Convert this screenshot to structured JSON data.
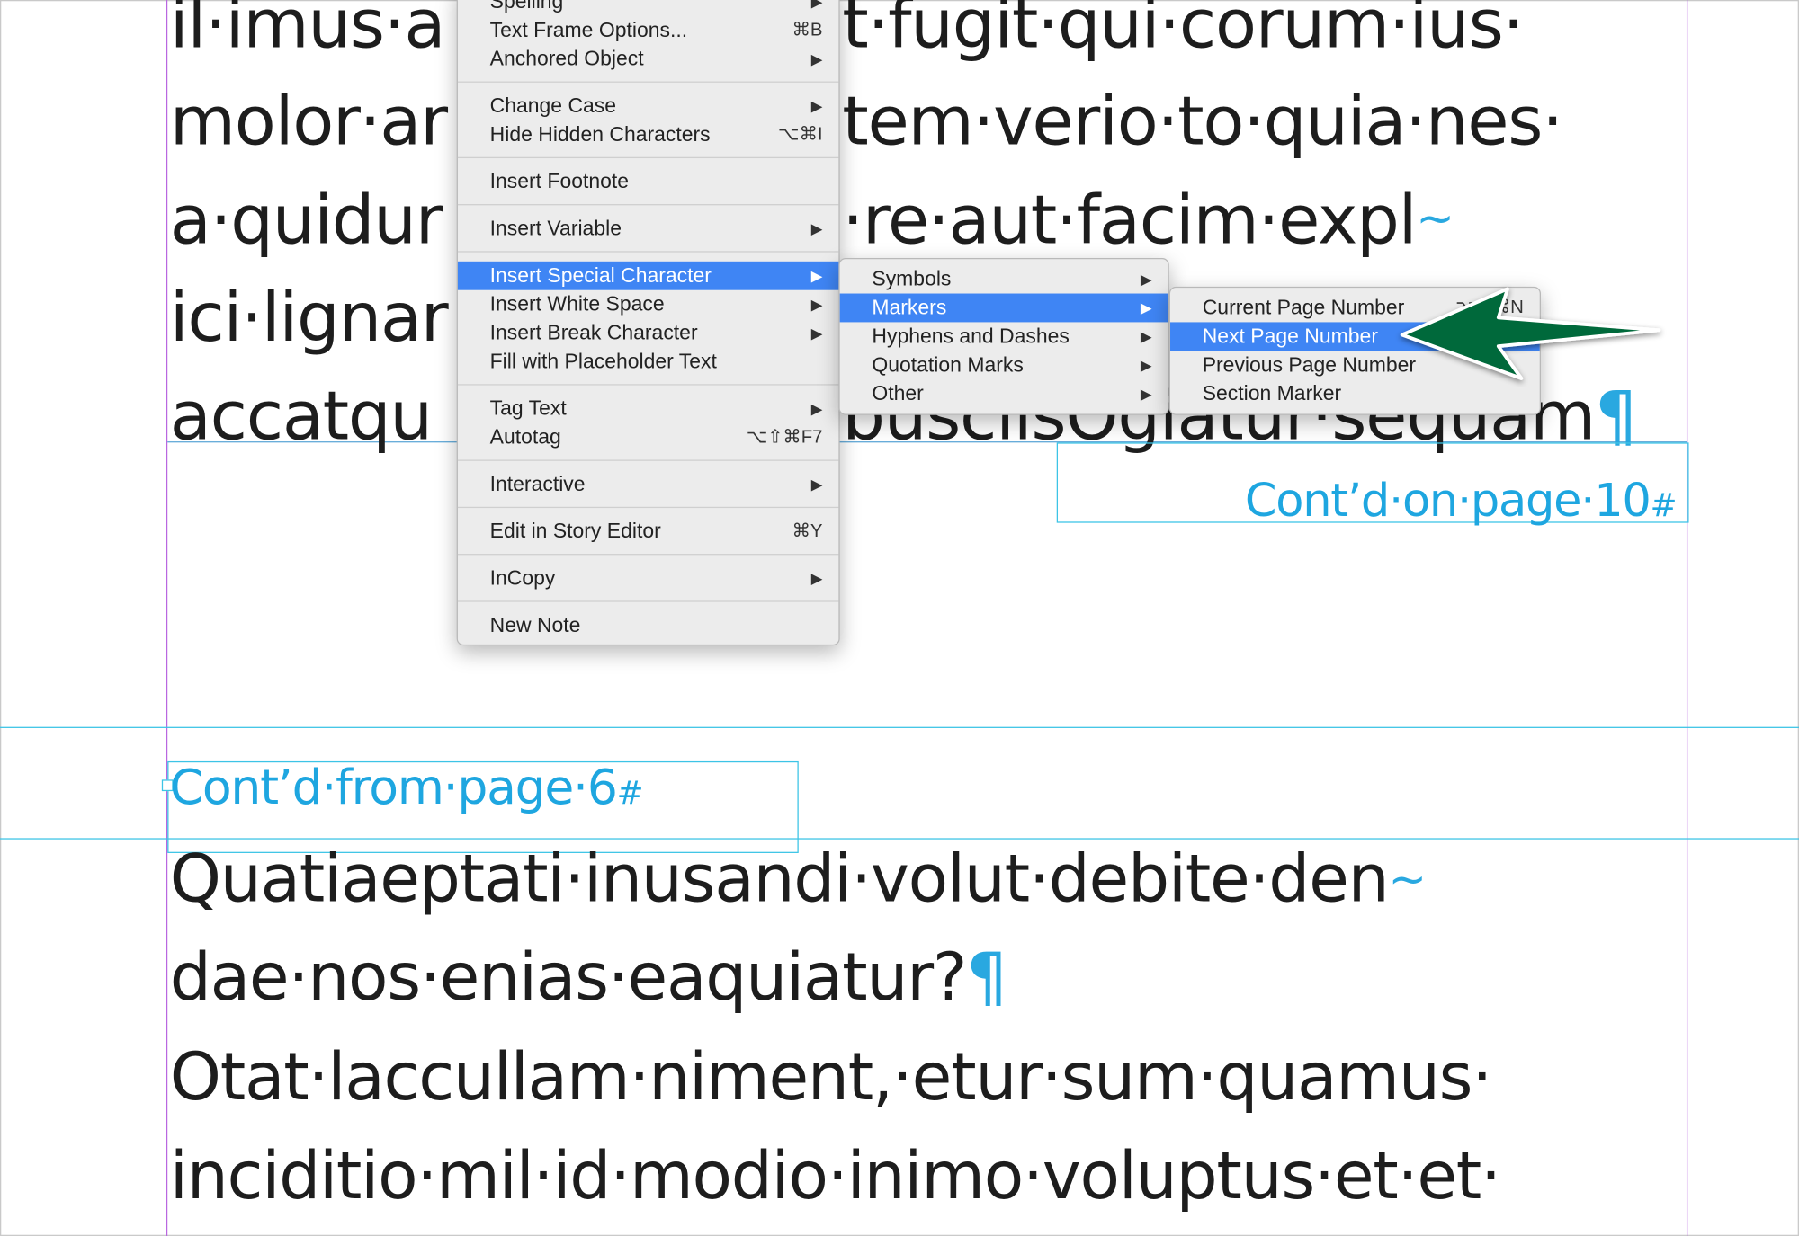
{
  "document": {
    "top_lines": [
      "il·imus·a",
      "molor·ar",
      "a·quidur",
      "ici·lignar",
      "accatqu"
    ],
    "top_lines_right": [
      "t·fugit·qui·corum·ius·",
      "tem·verio·to·quia·nes·",
      "·re·aut·facim·expl",
      "",
      "buscilsOgiatur·sequam"
    ],
    "hyphen_mark": "~",
    "pilcrow": "¶",
    "contd_on": "Cont’d·on·page·10",
    "contd_from": "Cont’d·from·page·6",
    "hash_mark": "#",
    "bottom_lines": [
      "Quatiaeptati·inusandi·volut·debite·den",
      "dae·nos·enias·eaquiatur?",
      "Otat·laccullam·niment,·etur·sum·quamus·",
      "inciditio·mil·id·modio·inimo·voluptus·et·et·"
    ]
  },
  "context_menu": {
    "items": [
      {
        "label": "Spelling",
        "arrow": "▶"
      },
      {
        "label": "Text Frame Options...",
        "shortcut": "⌘B"
      },
      {
        "label": "Anchored Object",
        "arrow": "▶"
      },
      {
        "label": "Change Case",
        "arrow": "▶"
      },
      {
        "label": "Hide Hidden Characters",
        "shortcut": "⌥⌘I"
      },
      {
        "label": "Insert Footnote"
      },
      {
        "label": "Insert Variable",
        "arrow": "▶"
      },
      {
        "label": "Insert Special Character",
        "arrow": "▶",
        "highlighted": true
      },
      {
        "label": "Insert White Space",
        "arrow": "▶"
      },
      {
        "label": "Insert Break Character",
        "arrow": "▶"
      },
      {
        "label": "Fill with Placeholder Text"
      },
      {
        "label": "Tag Text",
        "arrow": "▶"
      },
      {
        "label": "Autotag",
        "shortcut": "⌥⇧⌘F7"
      },
      {
        "label": "Interactive",
        "arrow": "▶"
      },
      {
        "label": "Edit in Story Editor",
        "shortcut": "⌘Y"
      },
      {
        "label": "InCopy",
        "arrow": "▶"
      },
      {
        "label": "New Note"
      }
    ]
  },
  "special_char_submenu": {
    "items": [
      {
        "label": "Symbols",
        "arrow": "▶"
      },
      {
        "label": "Markers",
        "arrow": "▶",
        "highlighted": true
      },
      {
        "label": "Hyphens and Dashes",
        "arrow": "▶"
      },
      {
        "label": "Quotation Marks",
        "arrow": "▶"
      },
      {
        "label": "Other",
        "arrow": "▶"
      }
    ]
  },
  "markers_submenu": {
    "items": [
      {
        "label": "Current Page Number",
        "shortcut": "⌥⇧⌘N"
      },
      {
        "label": "Next Page Number",
        "highlighted": true
      },
      {
        "label": "Previous Page Number"
      },
      {
        "label": "Section Marker"
      }
    ]
  },
  "colors": {
    "guide_cyan": "#3cc4e6",
    "margin_magenta": "#b967e0",
    "menu_highlight": "#3f85f4",
    "arrow_green": "#05693a",
    "hidden_char_blue": "#29a8e0"
  }
}
